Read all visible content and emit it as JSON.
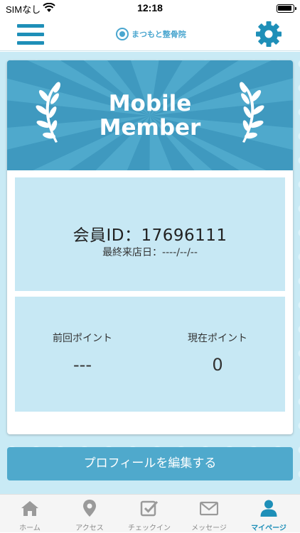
{
  "status_bar": {
    "carrier": "SIMなし",
    "time": "12:18"
  },
  "header": {
    "logo_text": "まつもと整骨院"
  },
  "banner": {
    "title_line1": "Mobile",
    "title_line2": "Member"
  },
  "member": {
    "id_text": "会員ID：17696111",
    "last_visit_text": "最終来店日：----/--/--"
  },
  "points": {
    "previous_label": "前回ポイント",
    "previous_value": "---",
    "current_label": "現在ポイント",
    "current_value": "0"
  },
  "edit_profile_label": "プロフィールを編集する",
  "tabs": [
    {
      "label": "ホーム",
      "icon": "home-icon"
    },
    {
      "label": "アクセス",
      "icon": "map-pin-icon"
    },
    {
      "label": "チェックイン",
      "icon": "checkin-icon"
    },
    {
      "label": "メッセージ",
      "icon": "mail-icon"
    },
    {
      "label": "マイページ",
      "icon": "user-icon"
    }
  ],
  "active_tab": "マイページ",
  "colors": {
    "accent": "#1e8fb8",
    "banner": "#4fa9cc",
    "panel": "#c7e8f4",
    "background": "#c9eaf5"
  }
}
